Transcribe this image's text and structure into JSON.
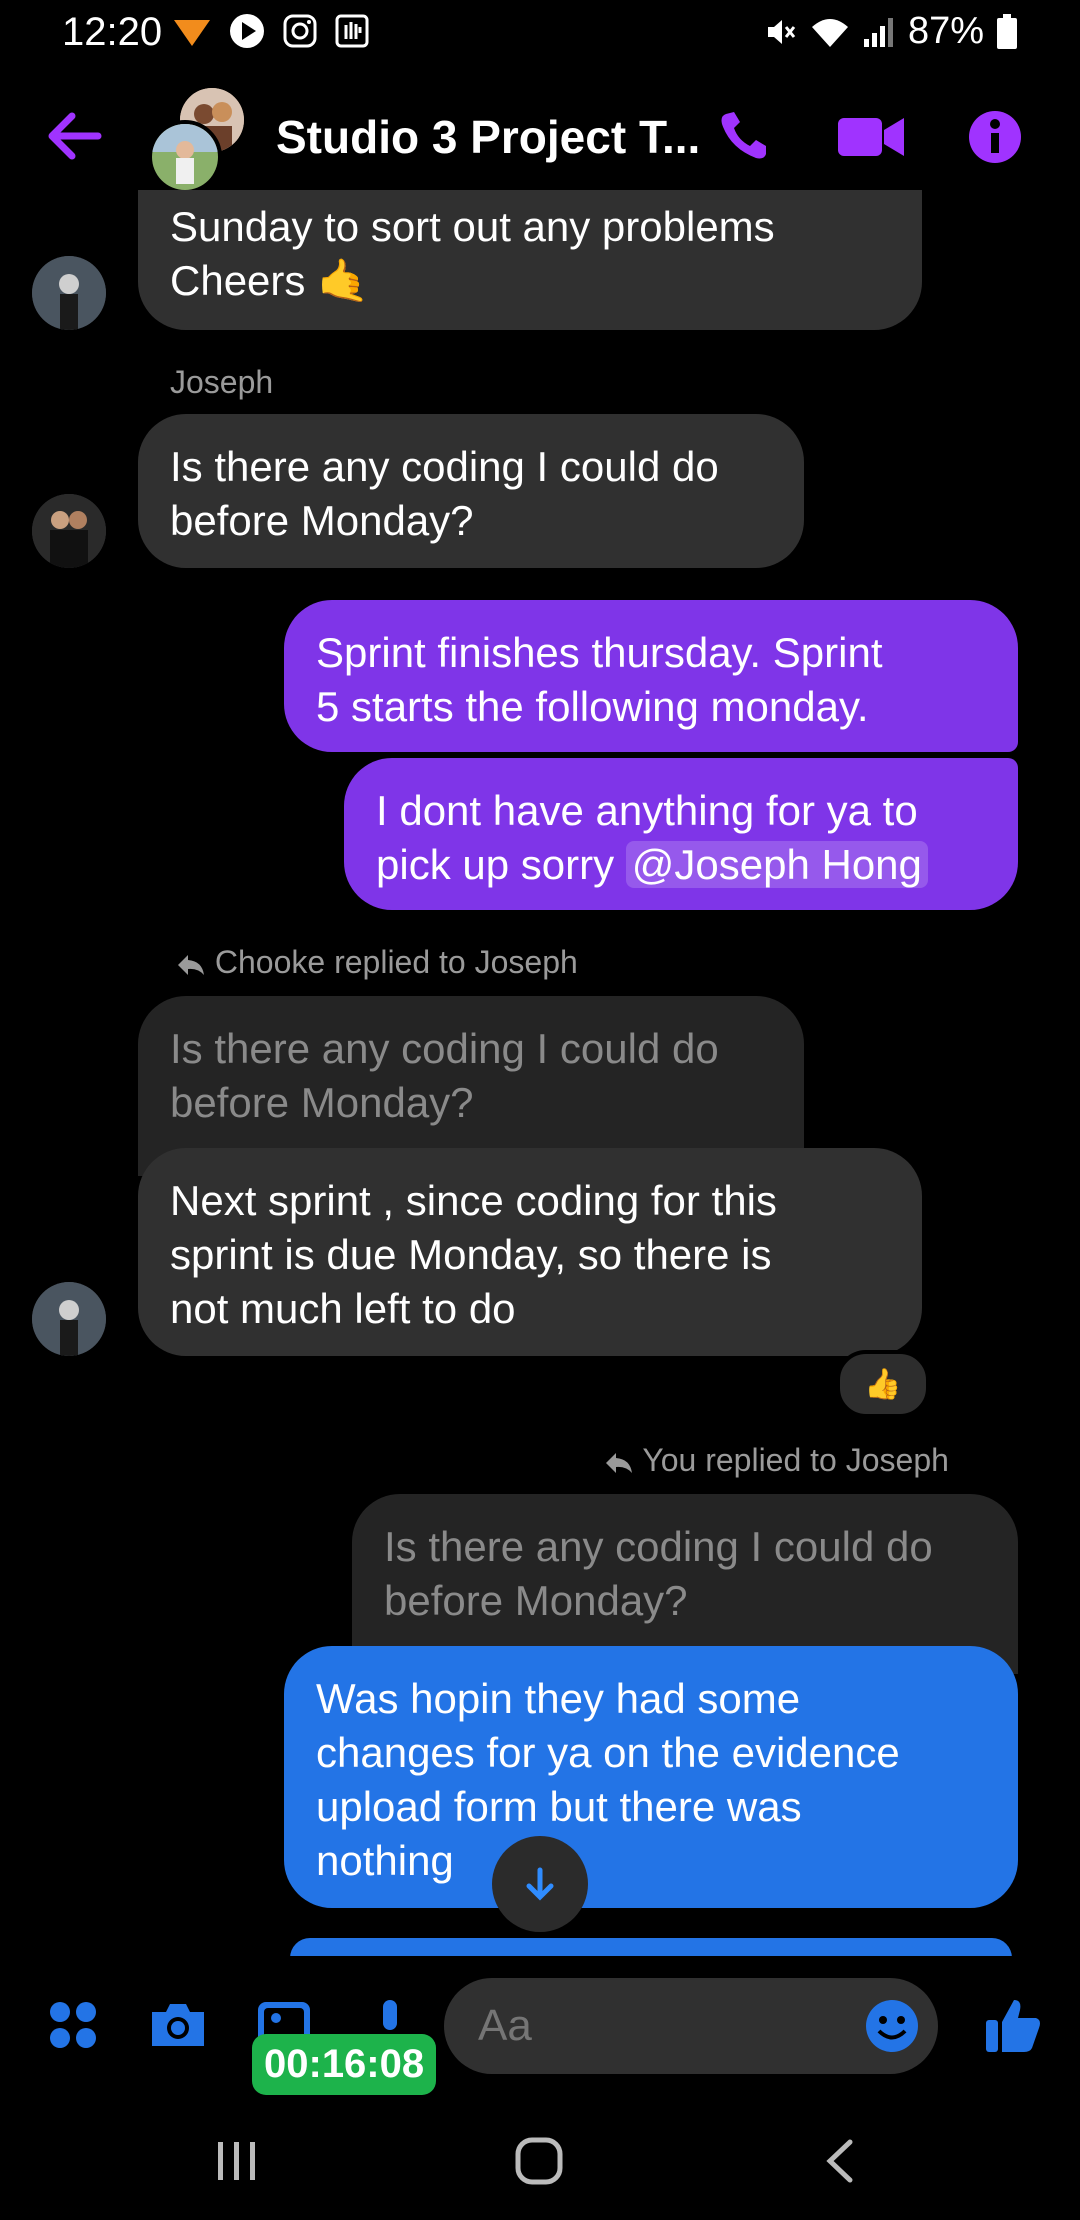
{
  "status_bar": {
    "time": "12:20",
    "battery": "87%"
  },
  "header": {
    "title": "Studio 3 Project T...",
    "back_icon": "arrow-left-icon",
    "call_icon": "phone-icon",
    "video_icon": "video-camera-icon",
    "info_icon": "info-icon"
  },
  "messages": [
    {
      "line1": "Sunday to sort out any problems",
      "line2": "Cheers 🤙"
    },
    {
      "sender": "Joseph",
      "line1": "Is there any coding I could do",
      "line2": "before Monday?"
    },
    {
      "line1": "Sprint finishes thursday. Sprint",
      "line2": "5 starts the following monday."
    },
    {
      "line1": "I dont have anything for ya to",
      "line2_prefix": "pick up sorry ",
      "mention": "@Joseph Hong"
    },
    {
      "reply_label": "Chooke replied to Joseph",
      "quote_line1": "Is there any coding I could do",
      "quote_line2": "before Monday?",
      "line1": "Next sprint , since coding for this",
      "line2": "sprint is due Monday, so there is",
      "line3": "not much left to do",
      "reaction": "👍"
    },
    {
      "reply_label": "You replied to Joseph",
      "quote_line1": "Is there any coding I could do",
      "quote_line2": "before Monday?",
      "line1": "Was hopin they had some",
      "line2": "changes for ya on the evidence",
      "line3": "upload form but there was",
      "line4": "nothing"
    }
  ],
  "composer": {
    "placeholder": "Aa",
    "timer": "00:16:08"
  },
  "colors": {
    "accent": "#a033ff",
    "blue": "#2374e6",
    "purple_bubble": "#7f35e8",
    "gray_bubble": "#303030"
  }
}
